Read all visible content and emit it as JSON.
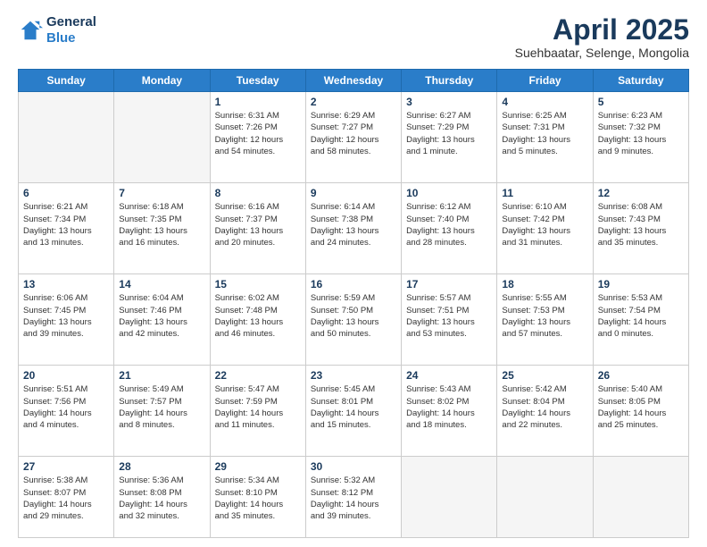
{
  "header": {
    "logo_general": "General",
    "logo_blue": "Blue",
    "month_title": "April 2025",
    "subtitle": "Suehbaatar, Selenge, Mongolia"
  },
  "weekdays": [
    "Sunday",
    "Monday",
    "Tuesday",
    "Wednesday",
    "Thursday",
    "Friday",
    "Saturday"
  ],
  "weeks": [
    [
      {
        "day": "",
        "detail": ""
      },
      {
        "day": "",
        "detail": ""
      },
      {
        "day": "1",
        "detail": "Sunrise: 6:31 AM\nSunset: 7:26 PM\nDaylight: 12 hours\nand 54 minutes."
      },
      {
        "day": "2",
        "detail": "Sunrise: 6:29 AM\nSunset: 7:27 PM\nDaylight: 12 hours\nand 58 minutes."
      },
      {
        "day": "3",
        "detail": "Sunrise: 6:27 AM\nSunset: 7:29 PM\nDaylight: 13 hours\nand 1 minute."
      },
      {
        "day": "4",
        "detail": "Sunrise: 6:25 AM\nSunset: 7:31 PM\nDaylight: 13 hours\nand 5 minutes."
      },
      {
        "day": "5",
        "detail": "Sunrise: 6:23 AM\nSunset: 7:32 PM\nDaylight: 13 hours\nand 9 minutes."
      }
    ],
    [
      {
        "day": "6",
        "detail": "Sunrise: 6:21 AM\nSunset: 7:34 PM\nDaylight: 13 hours\nand 13 minutes."
      },
      {
        "day": "7",
        "detail": "Sunrise: 6:18 AM\nSunset: 7:35 PM\nDaylight: 13 hours\nand 16 minutes."
      },
      {
        "day": "8",
        "detail": "Sunrise: 6:16 AM\nSunset: 7:37 PM\nDaylight: 13 hours\nand 20 minutes."
      },
      {
        "day": "9",
        "detail": "Sunrise: 6:14 AM\nSunset: 7:38 PM\nDaylight: 13 hours\nand 24 minutes."
      },
      {
        "day": "10",
        "detail": "Sunrise: 6:12 AM\nSunset: 7:40 PM\nDaylight: 13 hours\nand 28 minutes."
      },
      {
        "day": "11",
        "detail": "Sunrise: 6:10 AM\nSunset: 7:42 PM\nDaylight: 13 hours\nand 31 minutes."
      },
      {
        "day": "12",
        "detail": "Sunrise: 6:08 AM\nSunset: 7:43 PM\nDaylight: 13 hours\nand 35 minutes."
      }
    ],
    [
      {
        "day": "13",
        "detail": "Sunrise: 6:06 AM\nSunset: 7:45 PM\nDaylight: 13 hours\nand 39 minutes."
      },
      {
        "day": "14",
        "detail": "Sunrise: 6:04 AM\nSunset: 7:46 PM\nDaylight: 13 hours\nand 42 minutes."
      },
      {
        "day": "15",
        "detail": "Sunrise: 6:02 AM\nSunset: 7:48 PM\nDaylight: 13 hours\nand 46 minutes."
      },
      {
        "day": "16",
        "detail": "Sunrise: 5:59 AM\nSunset: 7:50 PM\nDaylight: 13 hours\nand 50 minutes."
      },
      {
        "day": "17",
        "detail": "Sunrise: 5:57 AM\nSunset: 7:51 PM\nDaylight: 13 hours\nand 53 minutes."
      },
      {
        "day": "18",
        "detail": "Sunrise: 5:55 AM\nSunset: 7:53 PM\nDaylight: 13 hours\nand 57 minutes."
      },
      {
        "day": "19",
        "detail": "Sunrise: 5:53 AM\nSunset: 7:54 PM\nDaylight: 14 hours\nand 0 minutes."
      }
    ],
    [
      {
        "day": "20",
        "detail": "Sunrise: 5:51 AM\nSunset: 7:56 PM\nDaylight: 14 hours\nand 4 minutes."
      },
      {
        "day": "21",
        "detail": "Sunrise: 5:49 AM\nSunset: 7:57 PM\nDaylight: 14 hours\nand 8 minutes."
      },
      {
        "day": "22",
        "detail": "Sunrise: 5:47 AM\nSunset: 7:59 PM\nDaylight: 14 hours\nand 11 minutes."
      },
      {
        "day": "23",
        "detail": "Sunrise: 5:45 AM\nSunset: 8:01 PM\nDaylight: 14 hours\nand 15 minutes."
      },
      {
        "day": "24",
        "detail": "Sunrise: 5:43 AM\nSunset: 8:02 PM\nDaylight: 14 hours\nand 18 minutes."
      },
      {
        "day": "25",
        "detail": "Sunrise: 5:42 AM\nSunset: 8:04 PM\nDaylight: 14 hours\nand 22 minutes."
      },
      {
        "day": "26",
        "detail": "Sunrise: 5:40 AM\nSunset: 8:05 PM\nDaylight: 14 hours\nand 25 minutes."
      }
    ],
    [
      {
        "day": "27",
        "detail": "Sunrise: 5:38 AM\nSunset: 8:07 PM\nDaylight: 14 hours\nand 29 minutes."
      },
      {
        "day": "28",
        "detail": "Sunrise: 5:36 AM\nSunset: 8:08 PM\nDaylight: 14 hours\nand 32 minutes."
      },
      {
        "day": "29",
        "detail": "Sunrise: 5:34 AM\nSunset: 8:10 PM\nDaylight: 14 hours\nand 35 minutes."
      },
      {
        "day": "30",
        "detail": "Sunrise: 5:32 AM\nSunset: 8:12 PM\nDaylight: 14 hours\nand 39 minutes."
      },
      {
        "day": "",
        "detail": ""
      },
      {
        "day": "",
        "detail": ""
      },
      {
        "day": "",
        "detail": ""
      }
    ]
  ]
}
